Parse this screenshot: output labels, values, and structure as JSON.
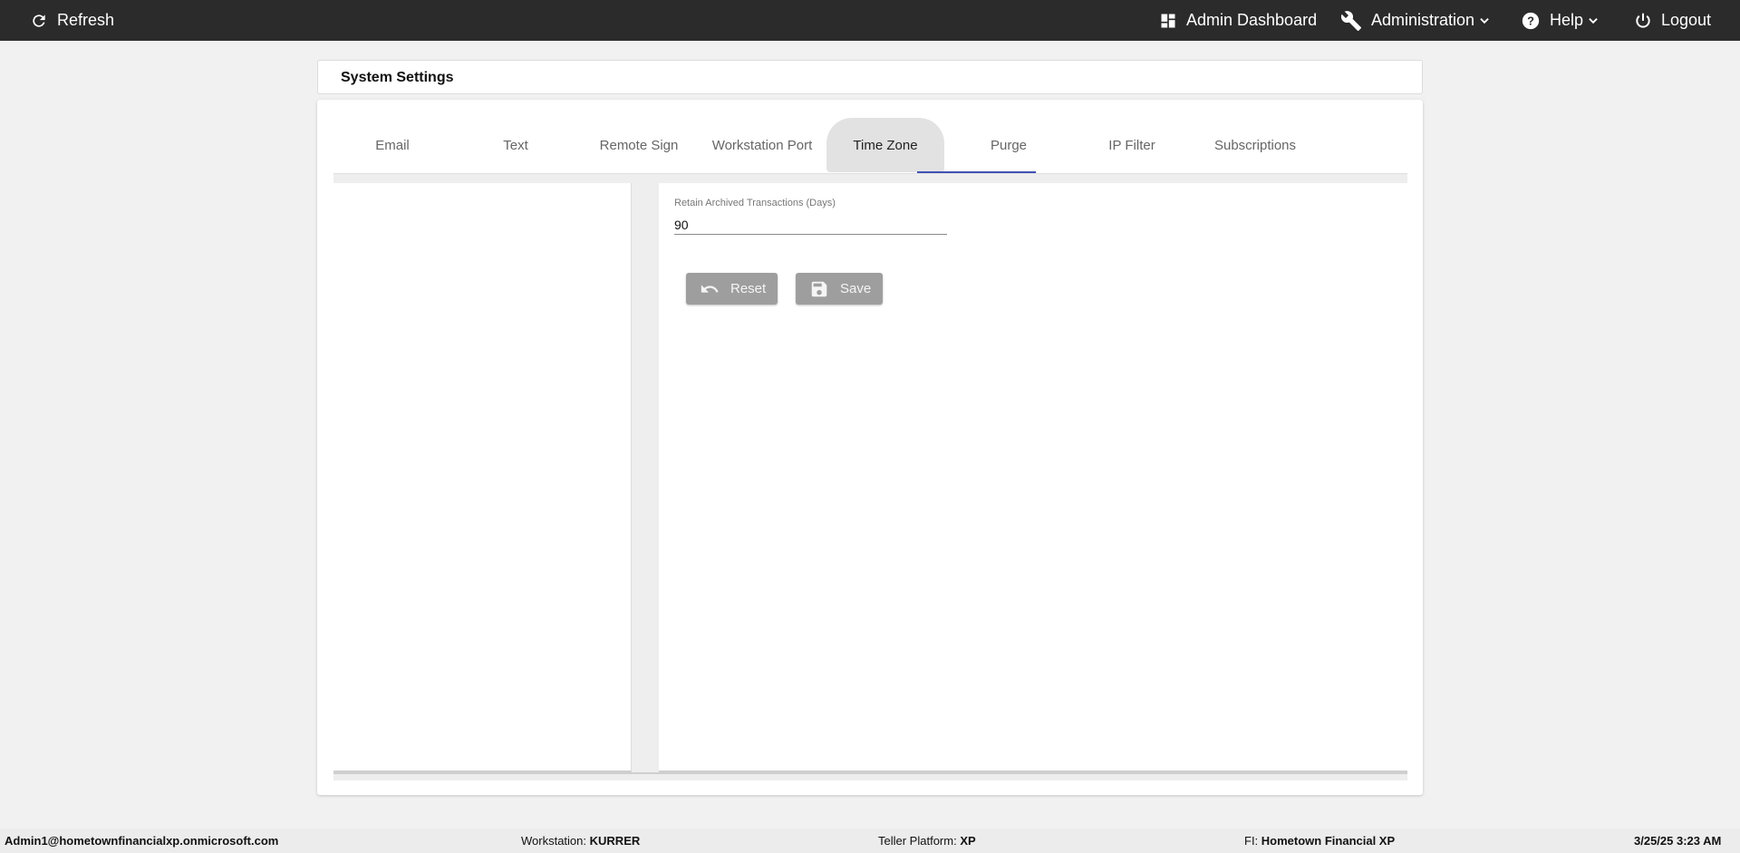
{
  "topbar": {
    "refresh_label": "Refresh",
    "admin_dashboard_label": "Admin Dashboard",
    "administration_label": "Administration",
    "help_label": "Help",
    "logout_label": "Logout",
    "icons": [
      "refresh-icon",
      "dashboard-icon",
      "wrench-icon",
      "help-circle-icon",
      "power-icon",
      "chevron-down-icon"
    ]
  },
  "page": {
    "title": "System Settings"
  },
  "tabs": [
    {
      "label": "Email"
    },
    {
      "label": "Text"
    },
    {
      "label": "Remote Sign"
    },
    {
      "label": "Workstation Port"
    },
    {
      "label": "Time Zone"
    },
    {
      "label": "Purge"
    },
    {
      "label": "IP Filter"
    },
    {
      "label": "Subscriptions"
    }
  ],
  "active_tab": "Purge",
  "hovered_tab": "Time Zone",
  "purge_form": {
    "retain_label": "Retain Archived Transactions (Days)",
    "retain_value": "90",
    "reset_label": "Reset",
    "save_label": "Save"
  },
  "footer": {
    "user": "Admin1@hometownfinancialxp.onmicrosoft.com",
    "workstation_label": "Workstation:",
    "workstation_value": "KURRER",
    "teller_platform_label": "Teller Platform:",
    "teller_platform_value": "XP",
    "fi_label": "FI:",
    "fi_value": "Hometown Financial XP",
    "datetime": "3/25/25 3:23 AM"
  },
  "colors": {
    "topbar_bg": "#2b2b2b",
    "tab_indicator": "#3f51b5",
    "button_disabled": "#9e9e9e"
  }
}
